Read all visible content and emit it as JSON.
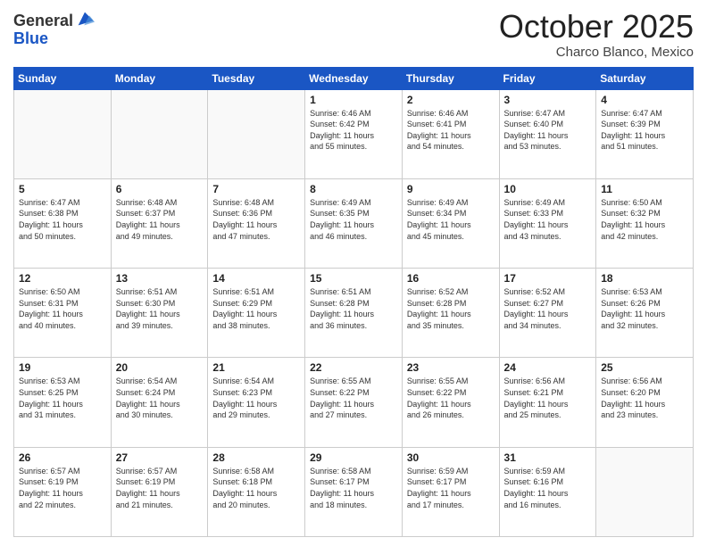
{
  "logo": {
    "general": "General",
    "blue": "Blue"
  },
  "header": {
    "month": "October 2025",
    "location": "Charco Blanco, Mexico"
  },
  "weekdays": [
    "Sunday",
    "Monday",
    "Tuesday",
    "Wednesday",
    "Thursday",
    "Friday",
    "Saturday"
  ],
  "weeks": [
    [
      {
        "day": "",
        "info": ""
      },
      {
        "day": "",
        "info": ""
      },
      {
        "day": "",
        "info": ""
      },
      {
        "day": "1",
        "info": "Sunrise: 6:46 AM\nSunset: 6:42 PM\nDaylight: 11 hours\nand 55 minutes."
      },
      {
        "day": "2",
        "info": "Sunrise: 6:46 AM\nSunset: 6:41 PM\nDaylight: 11 hours\nand 54 minutes."
      },
      {
        "day": "3",
        "info": "Sunrise: 6:47 AM\nSunset: 6:40 PM\nDaylight: 11 hours\nand 53 minutes."
      },
      {
        "day": "4",
        "info": "Sunrise: 6:47 AM\nSunset: 6:39 PM\nDaylight: 11 hours\nand 51 minutes."
      }
    ],
    [
      {
        "day": "5",
        "info": "Sunrise: 6:47 AM\nSunset: 6:38 PM\nDaylight: 11 hours\nand 50 minutes."
      },
      {
        "day": "6",
        "info": "Sunrise: 6:48 AM\nSunset: 6:37 PM\nDaylight: 11 hours\nand 49 minutes."
      },
      {
        "day": "7",
        "info": "Sunrise: 6:48 AM\nSunset: 6:36 PM\nDaylight: 11 hours\nand 47 minutes."
      },
      {
        "day": "8",
        "info": "Sunrise: 6:49 AM\nSunset: 6:35 PM\nDaylight: 11 hours\nand 46 minutes."
      },
      {
        "day": "9",
        "info": "Sunrise: 6:49 AM\nSunset: 6:34 PM\nDaylight: 11 hours\nand 45 minutes."
      },
      {
        "day": "10",
        "info": "Sunrise: 6:49 AM\nSunset: 6:33 PM\nDaylight: 11 hours\nand 43 minutes."
      },
      {
        "day": "11",
        "info": "Sunrise: 6:50 AM\nSunset: 6:32 PM\nDaylight: 11 hours\nand 42 minutes."
      }
    ],
    [
      {
        "day": "12",
        "info": "Sunrise: 6:50 AM\nSunset: 6:31 PM\nDaylight: 11 hours\nand 40 minutes."
      },
      {
        "day": "13",
        "info": "Sunrise: 6:51 AM\nSunset: 6:30 PM\nDaylight: 11 hours\nand 39 minutes."
      },
      {
        "day": "14",
        "info": "Sunrise: 6:51 AM\nSunset: 6:29 PM\nDaylight: 11 hours\nand 38 minutes."
      },
      {
        "day": "15",
        "info": "Sunrise: 6:51 AM\nSunset: 6:28 PM\nDaylight: 11 hours\nand 36 minutes."
      },
      {
        "day": "16",
        "info": "Sunrise: 6:52 AM\nSunset: 6:28 PM\nDaylight: 11 hours\nand 35 minutes."
      },
      {
        "day": "17",
        "info": "Sunrise: 6:52 AM\nSunset: 6:27 PM\nDaylight: 11 hours\nand 34 minutes."
      },
      {
        "day": "18",
        "info": "Sunrise: 6:53 AM\nSunset: 6:26 PM\nDaylight: 11 hours\nand 32 minutes."
      }
    ],
    [
      {
        "day": "19",
        "info": "Sunrise: 6:53 AM\nSunset: 6:25 PM\nDaylight: 11 hours\nand 31 minutes."
      },
      {
        "day": "20",
        "info": "Sunrise: 6:54 AM\nSunset: 6:24 PM\nDaylight: 11 hours\nand 30 minutes."
      },
      {
        "day": "21",
        "info": "Sunrise: 6:54 AM\nSunset: 6:23 PM\nDaylight: 11 hours\nand 29 minutes."
      },
      {
        "day": "22",
        "info": "Sunrise: 6:55 AM\nSunset: 6:22 PM\nDaylight: 11 hours\nand 27 minutes."
      },
      {
        "day": "23",
        "info": "Sunrise: 6:55 AM\nSunset: 6:22 PM\nDaylight: 11 hours\nand 26 minutes."
      },
      {
        "day": "24",
        "info": "Sunrise: 6:56 AM\nSunset: 6:21 PM\nDaylight: 11 hours\nand 25 minutes."
      },
      {
        "day": "25",
        "info": "Sunrise: 6:56 AM\nSunset: 6:20 PM\nDaylight: 11 hours\nand 23 minutes."
      }
    ],
    [
      {
        "day": "26",
        "info": "Sunrise: 6:57 AM\nSunset: 6:19 PM\nDaylight: 11 hours\nand 22 minutes."
      },
      {
        "day": "27",
        "info": "Sunrise: 6:57 AM\nSunset: 6:19 PM\nDaylight: 11 hours\nand 21 minutes."
      },
      {
        "day": "28",
        "info": "Sunrise: 6:58 AM\nSunset: 6:18 PM\nDaylight: 11 hours\nand 20 minutes."
      },
      {
        "day": "29",
        "info": "Sunrise: 6:58 AM\nSunset: 6:17 PM\nDaylight: 11 hours\nand 18 minutes."
      },
      {
        "day": "30",
        "info": "Sunrise: 6:59 AM\nSunset: 6:17 PM\nDaylight: 11 hours\nand 17 minutes."
      },
      {
        "day": "31",
        "info": "Sunrise: 6:59 AM\nSunset: 6:16 PM\nDaylight: 11 hours\nand 16 minutes."
      },
      {
        "day": "",
        "info": ""
      }
    ]
  ]
}
